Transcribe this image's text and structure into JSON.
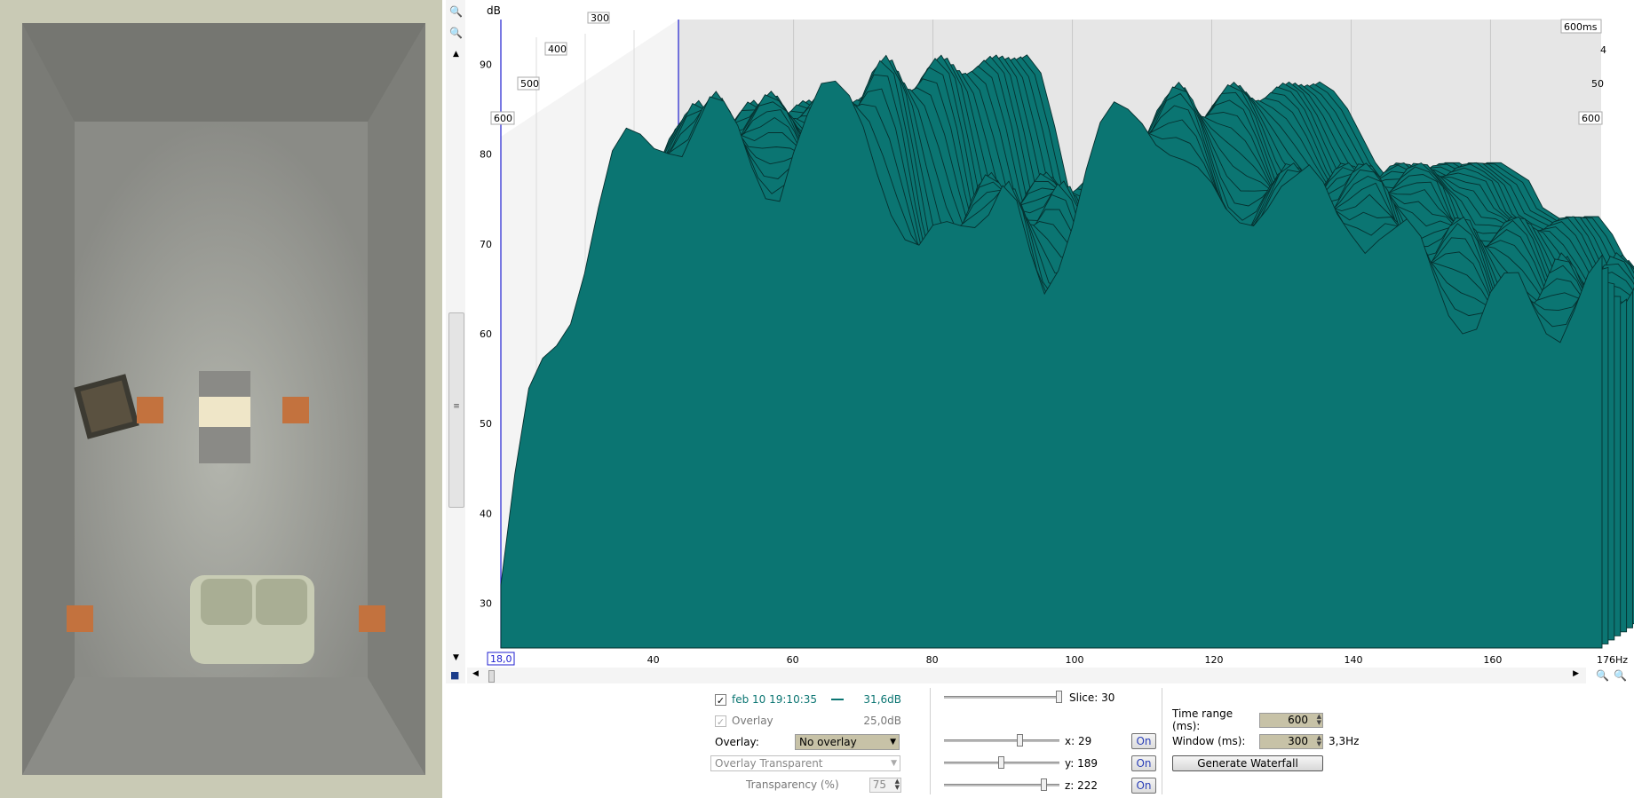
{
  "chart_data": {
    "type": "area",
    "subtype": "waterfall",
    "ylabel": "dB",
    "xunit": "Hz",
    "xlim": [
      18.0,
      176
    ],
    "ylim": [
      25,
      95
    ],
    "x_start_label": "18,0",
    "x_ticks": [
      "40",
      "60",
      "80",
      "100",
      "120",
      "140",
      "160"
    ],
    "x_end_label": "176Hz",
    "y_ticks": [
      "30",
      "40",
      "50",
      "60",
      "70",
      "80",
      "90"
    ],
    "time_ticks_left": [
      "600",
      "500",
      "400",
      "300"
    ],
    "time_ticks_right": [
      "600ms",
      "4",
      "50",
      "600"
    ],
    "fill_color": "#0b7572",
    "grid": true,
    "num_slices": 30,
    "front_slice": {
      "x": [
        18,
        20,
        22,
        24,
        26,
        28,
        30,
        32,
        34,
        36,
        38,
        40,
        42,
        44,
        46,
        48,
        50,
        52,
        54,
        56,
        58,
        60,
        62,
        64,
        66,
        68,
        70,
        72,
        74,
        76,
        78,
        80,
        82,
        84,
        86,
        88,
        90,
        92,
        94,
        96,
        98,
        100,
        102,
        104,
        106,
        108,
        110,
        112,
        114,
        116,
        118,
        120,
        122,
        124,
        126,
        128,
        130,
        132,
        134,
        136,
        138,
        140,
        142,
        144,
        146,
        148,
        150,
        152,
        154,
        156,
        158,
        160,
        162,
        164,
        166,
        168,
        170,
        172,
        174,
        176
      ],
      "y": [
        38,
        48,
        57,
        62,
        66,
        70,
        75,
        80,
        84,
        86,
        87,
        88,
        89,
        88,
        89,
        90,
        89,
        88,
        86,
        84,
        83,
        86,
        88,
        91,
        93,
        94,
        92,
        86,
        79,
        74,
        73,
        77,
        80,
        81,
        80,
        79,
        80,
        78,
        74,
        72,
        76,
        80,
        84,
        87,
        89,
        90,
        91,
        90,
        88,
        85,
        82,
        80,
        79,
        80,
        81,
        82,
        82,
        81,
        82,
        82,
        81,
        80,
        77,
        76,
        75,
        76,
        76,
        74,
        71,
        68,
        66,
        68,
        70,
        72,
        71,
        69,
        67,
        68,
        70,
        72
      ]
    }
  },
  "chart_labels": {
    "y_unit": "dB",
    "time_top": "300",
    "time_600": "600",
    "time_500": "500",
    "time_400": "400",
    "time_600ms": "600ms",
    "time_r4": "4",
    "time_r50": "50",
    "time_r600": "600"
  },
  "legend": {
    "measurement_label": "feb 10 19:10:35",
    "measurement_checked": true,
    "measurement_value": "31,6dB",
    "measurement_color": "#0b7572",
    "overlay_label": "Overlay",
    "overlay_value": "25,0dB",
    "overlay_select_label": "Overlay:",
    "overlay_select_value": "No overlay",
    "overlay_mode_value": "Overlay Transparent",
    "transparency_label": "Transparency (%)",
    "transparency_value": "75"
  },
  "view": {
    "slice_label": "Slice: 30",
    "x_label": "x: 29",
    "y_label": "y: 189",
    "z_label": "z: 222",
    "on_label": "On",
    "slice_level": 30,
    "x_level": 29,
    "y_level": 189,
    "z_level": 222
  },
  "settings": {
    "time_range_label": "Time range (ms):",
    "time_range_value": "600",
    "window_label": "Window (ms):",
    "window_value": "300",
    "resolution": "3,3Hz",
    "generate_label": "Generate Waterfall"
  }
}
